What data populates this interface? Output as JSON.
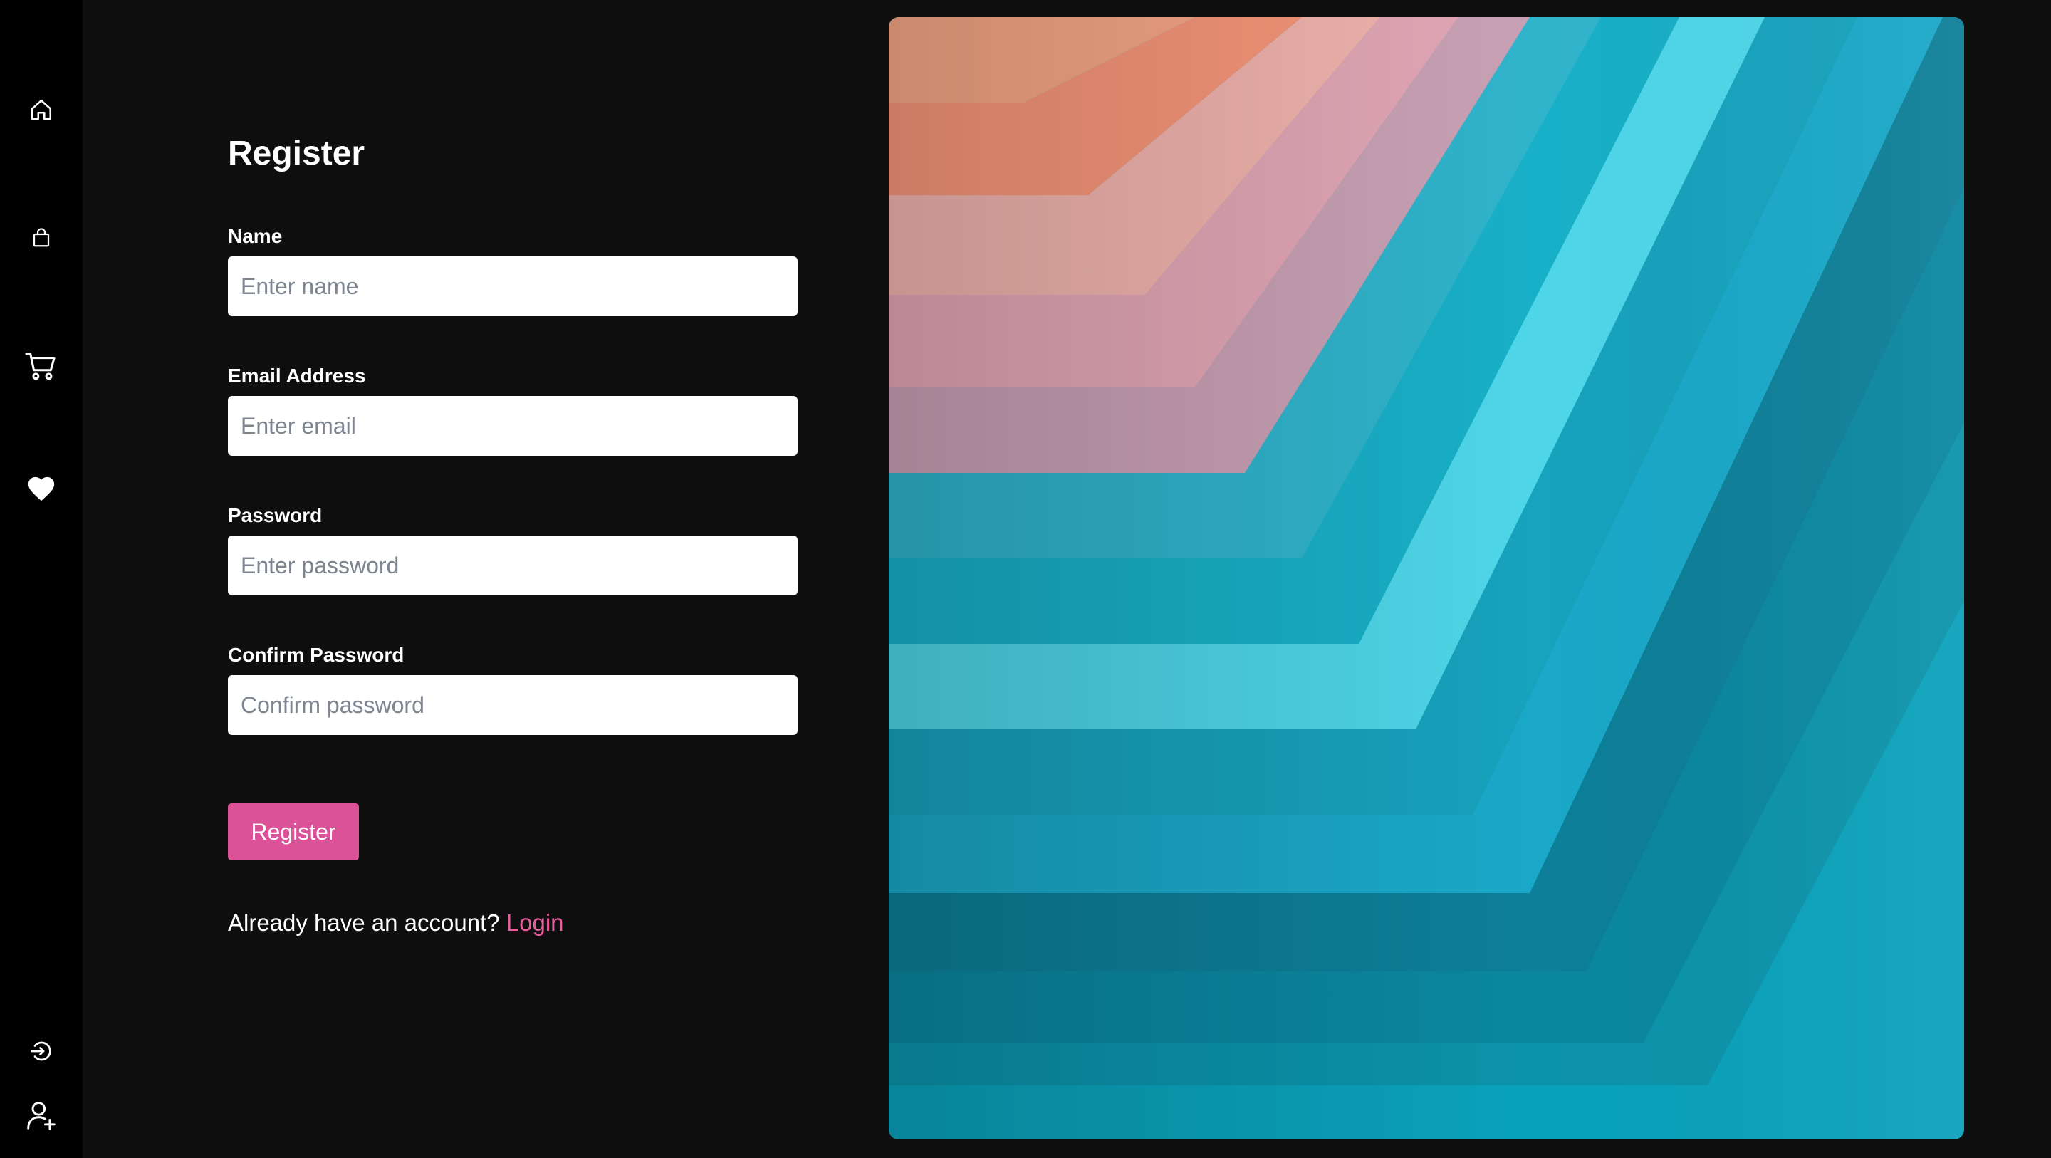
{
  "sidebar": {
    "top_items": [
      {
        "icon": "home-icon"
      },
      {
        "icon": "shopping-bag-icon"
      },
      {
        "icon": "shopping-cart-icon"
      },
      {
        "icon": "heart-icon"
      }
    ],
    "bottom_items": [
      {
        "icon": "login-icon"
      },
      {
        "icon": "add-user-icon"
      }
    ]
  },
  "form": {
    "title": "Register",
    "fields": {
      "name": {
        "label": "Name",
        "placeholder": "Enter name",
        "value": ""
      },
      "email": {
        "label": "Email Address",
        "placeholder": "Enter email",
        "value": ""
      },
      "password": {
        "label": "Password",
        "placeholder": "Enter password",
        "value": ""
      },
      "confirm": {
        "label": "Confirm Password",
        "placeholder": "Confirm password",
        "value": ""
      }
    },
    "submit_label": "Register",
    "footer_prompt": "Already have an account?",
    "footer_link": "Login"
  },
  "colors": {
    "accent": "#dc5299",
    "link": "#e95d9f",
    "background": "#0f0f0f",
    "sidebar": "#000000"
  }
}
